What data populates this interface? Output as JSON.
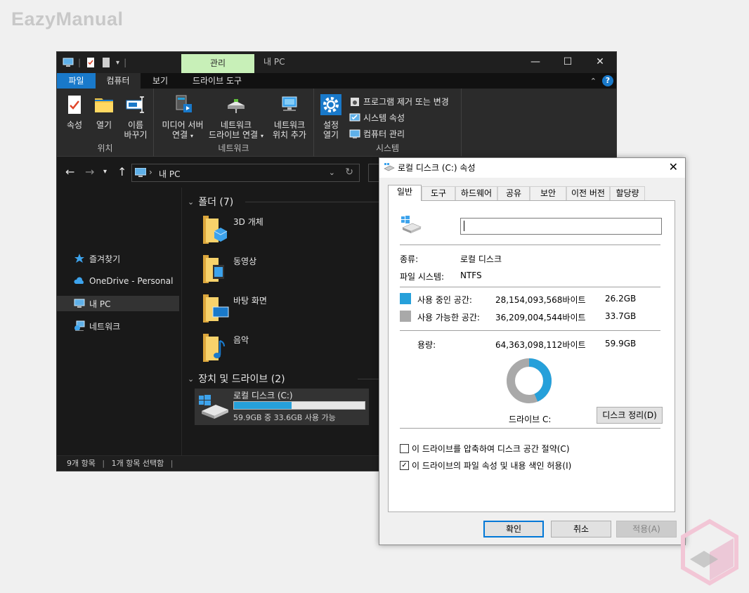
{
  "watermark": "EazyManual",
  "explorer": {
    "titlebar": {
      "manage_tab": "관리",
      "title": "내 PC"
    },
    "ribbon_tabs": {
      "file": "파일",
      "computer": "컴퓨터",
      "view": "보기",
      "drive_tools": "드라이브 도구"
    },
    "ribbon": {
      "location": {
        "label": "위치",
        "properties": "속성",
        "open": "열기",
        "rename_line1": "이름",
        "rename_line2": "바꾸기"
      },
      "network": {
        "label": "네트워크",
        "media_line1": "미디어 서버",
        "media_line2": "연결",
        "map_line1": "네트워크",
        "map_line2": "드라이브 연결",
        "add_line1": "네트워크",
        "add_line2": "위치 추가"
      },
      "system": {
        "label": "시스템",
        "settings_line1": "설정",
        "settings_line2": "열기",
        "uninstall": "프로그램 제거 또는 변경",
        "sys_props": "시스템 속성",
        "manage": "컴퓨터 관리"
      }
    },
    "address": {
      "path": "내 PC",
      "separator": "›"
    },
    "nav_pane": [
      {
        "label": "즐겨찾기"
      },
      {
        "label": "OneDrive - Personal"
      },
      {
        "label": "내 PC"
      },
      {
        "label": "네트워크"
      }
    ],
    "folders_header": "폴더 (7)",
    "folders": [
      "3D 개체",
      "동영상",
      "바탕 화면",
      "음악"
    ],
    "devices_header": "장치 및 드라이브 (2)",
    "drive": {
      "name": "로컬 디스크 (C:)",
      "free_text": "59.9GB 중 33.6GB 사용 가능",
      "used_fraction": 0.44
    },
    "status": {
      "items": "9개 항목",
      "selected": "1개 항목 선택함"
    }
  },
  "dialog": {
    "title": "로컬 디스크 (C:) 속성",
    "tabs": [
      "일반",
      "도구",
      "하드웨어",
      "공유",
      "보안",
      "이전 버전",
      "할당량"
    ],
    "name_value": "",
    "type_label": "종류:",
    "type_value": "로컬 디스크",
    "fs_label": "파일 시스템:",
    "fs_value": "NTFS",
    "used": {
      "label": "사용 중인 공간:",
      "bytes": "28,154,093,568바이트",
      "size": "26.2GB",
      "color": "#26a0da"
    },
    "free": {
      "label": "사용 가능한 공간:",
      "bytes": "36,209,004,544바이트",
      "size": "33.7GB",
      "color": "#a9a9a9"
    },
    "capacity": {
      "label": "용량:",
      "bytes": "64,363,098,112바이트",
      "size": "59.9GB"
    },
    "used_fraction": 0.437,
    "drive_label": "드라이브 C:",
    "cleanup_button": "디스크 정리(D)",
    "compress_label": "이 드라이브를 압축하여 디스크 공간 절약(C)",
    "compress_checked": false,
    "index_label": "이 드라이브의 파일 속성 및 내용 색인 허용(I)",
    "index_checked": true,
    "buttons": {
      "ok": "확인",
      "cancel": "취소",
      "apply": "적용(A)"
    }
  }
}
